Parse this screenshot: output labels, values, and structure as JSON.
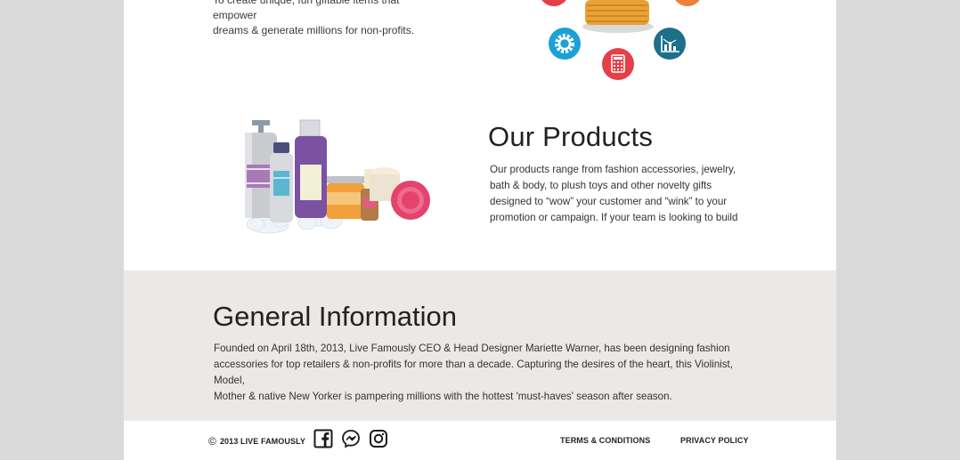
{
  "mission": {
    "text_line1": "To create unique, fun giftable items that empower",
    "text_line2": "dreams & generate millions for non-profits."
  },
  "products": {
    "title": "Our Products",
    "body_lines": [
      "Our products range from fashion accessories, jewelry,",
      "bath & body, to plush toys and other novelty gifts",
      "designed to “wow” your customer and “wink” to your",
      "promotion or campaign. If your team is looking to build"
    ]
  },
  "general": {
    "title": "General Information",
    "body_lines": [
      "Founded on April 18th, 2013, Live Famously CEO & Head Designer Mariette Warner, has been designing fashion",
      "accessories for top retailers & non-profits for more than a decade. Capturing the desires of the heart, this Violinist, Model,",
      "Mother & native New Yorker is pampering millions with the hottest 'must-haves' season after season."
    ]
  },
  "footer": {
    "copyright_symbol": "©",
    "copyright_text": "2013 LIVE FAMOUSLY",
    "social_icons": [
      "facebook-icon",
      "messenger-icon",
      "instagram-icon"
    ],
    "terms_label": "TERMS & CONDITIONS",
    "privacy_label": "PRIVACY POLICY"
  },
  "colors": {
    "page_bg": "#dadada",
    "content_bg": "#ffffff",
    "section_bg": "#ebe8e5",
    "text_dark": "#222222",
    "icon_red": "#e53f47",
    "icon_blue": "#1ba1d6",
    "icon_teal": "#1d6f8a",
    "icon_orange": "#f07f3c"
  }
}
